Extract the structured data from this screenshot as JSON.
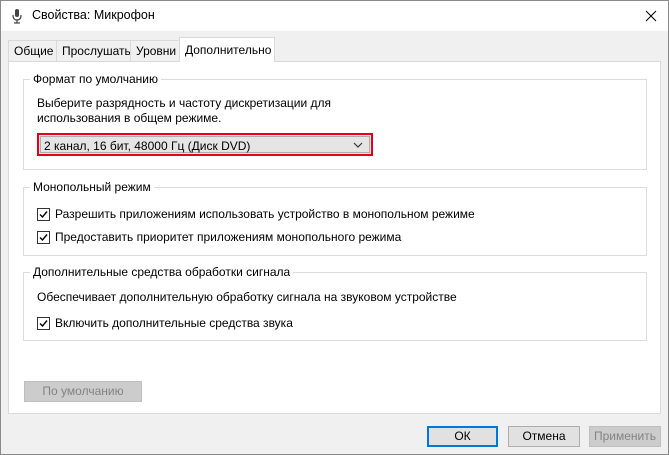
{
  "window": {
    "title": "Свойства: Микрофон"
  },
  "tabs": [
    {
      "label": "Общие"
    },
    {
      "label": "Прослушать"
    },
    {
      "label": "Уровни"
    },
    {
      "label": "Дополнительно"
    }
  ],
  "default_format": {
    "legend": "Формат по умолчанию",
    "description_line1": "Выберите разрядность и частоту дискретизации для",
    "description_line2": "использования в общем режиме.",
    "selected_format": "2 канал, 16 бит, 48000 Гц (Диск DVD)"
  },
  "exclusive_mode": {
    "legend": "Монопольный режим",
    "option1": {
      "label": "Разрешить приложениям использовать устройство в монопольном режиме",
      "checked": true
    },
    "option2": {
      "label": "Предоставить приоритет приложениям монопольного режима",
      "checked": true
    }
  },
  "signal_enhancements": {
    "legend": "Дополнительные средства обработки сигнала",
    "description": "Обеспечивает дополнительную обработку сигнала на звуковом устройстве",
    "option1": {
      "label": "Включить дополнительные средства звука",
      "checked": true
    }
  },
  "buttons": {
    "restore_defaults": "По умолчанию",
    "ok": "ОК",
    "cancel": "Отмена",
    "apply": "Применить"
  },
  "colors": {
    "highlight_border": "#e3001b",
    "default_button_border": "#0078d7"
  }
}
